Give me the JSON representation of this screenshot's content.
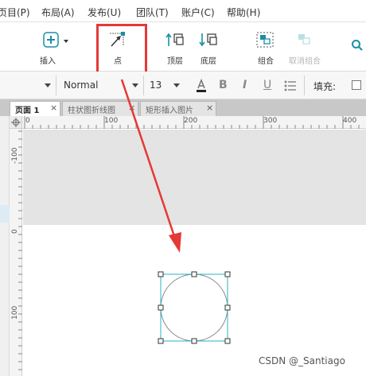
{
  "menubar": {
    "items": [
      {
        "label": "页目(P)"
      },
      {
        "label": "布局(A)"
      },
      {
        "label": "发布(U)"
      },
      {
        "label": "团队(T)"
      },
      {
        "label": "账户(C)"
      },
      {
        "label": "帮助(H)"
      }
    ]
  },
  "toolbar": {
    "insert_label": "插入",
    "point_label": "点",
    "top_layer_label": "顶层",
    "bottom_layer_label": "底层",
    "group_label": "组合",
    "ungroup_label": "取消组合"
  },
  "formatbar": {
    "font_name": "Normal",
    "font_size": "13",
    "bold": "B",
    "italic": "I",
    "underline": "U",
    "fill_label": "填充:"
  },
  "tabs": [
    {
      "label": "页面 1",
      "close": "×"
    },
    {
      "label": "柱状图折线图",
      "close": "×"
    },
    {
      "label": "矩形插入图片",
      "close": "×"
    }
  ],
  "ruler": {
    "h_labels": [
      "0",
      "100",
      "200",
      "300",
      "400"
    ],
    "v_labels": [
      "-100",
      "0",
      "100"
    ]
  },
  "colors": {
    "highlight": "#e53935",
    "arrow": "#e53935",
    "selection": "#26b6c4",
    "icon_accent": "#1a8fa6"
  },
  "watermark": "CSDN @_Santiago"
}
